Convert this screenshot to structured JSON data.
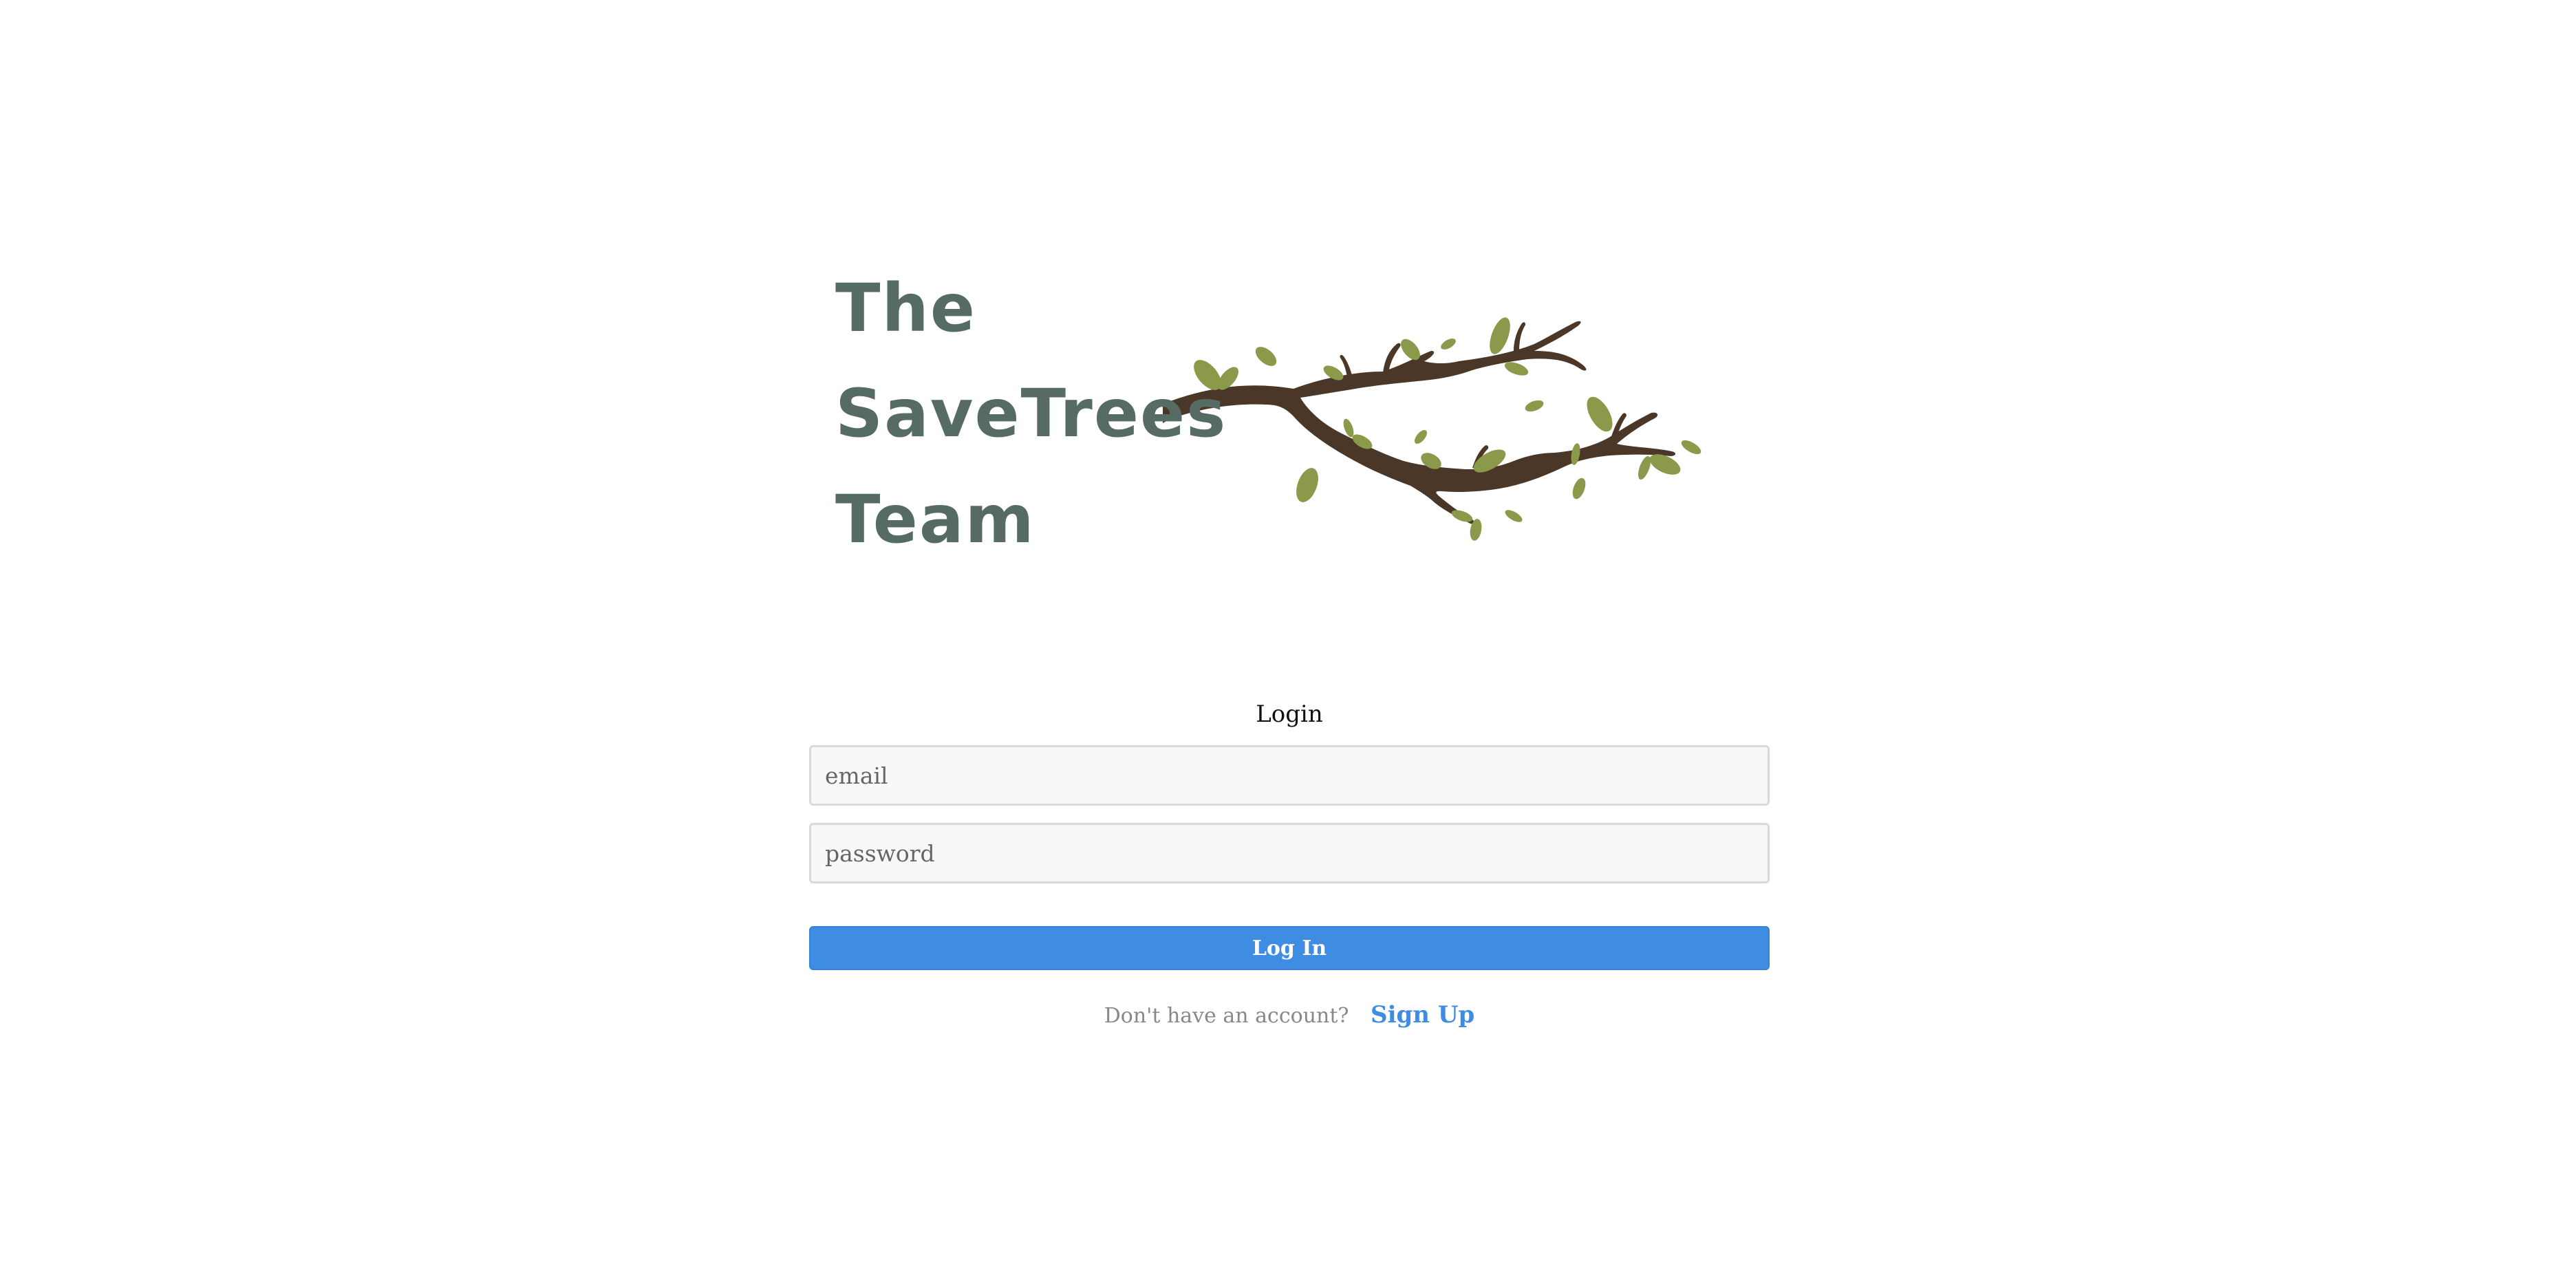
{
  "logo": {
    "line1": "The",
    "line2": "SaveTrees",
    "line3": "Team",
    "text_color": "#556b63",
    "branch_color": "#4a3728",
    "leaf_color": "#8a9a4a"
  },
  "login": {
    "title": "Login",
    "email_placeholder": "email",
    "password_placeholder": "password",
    "submit_label": "Log In",
    "signup_prompt": "Don't have an account?",
    "signup_link": "Sign Up",
    "accent_color": "#3f8ce3"
  }
}
